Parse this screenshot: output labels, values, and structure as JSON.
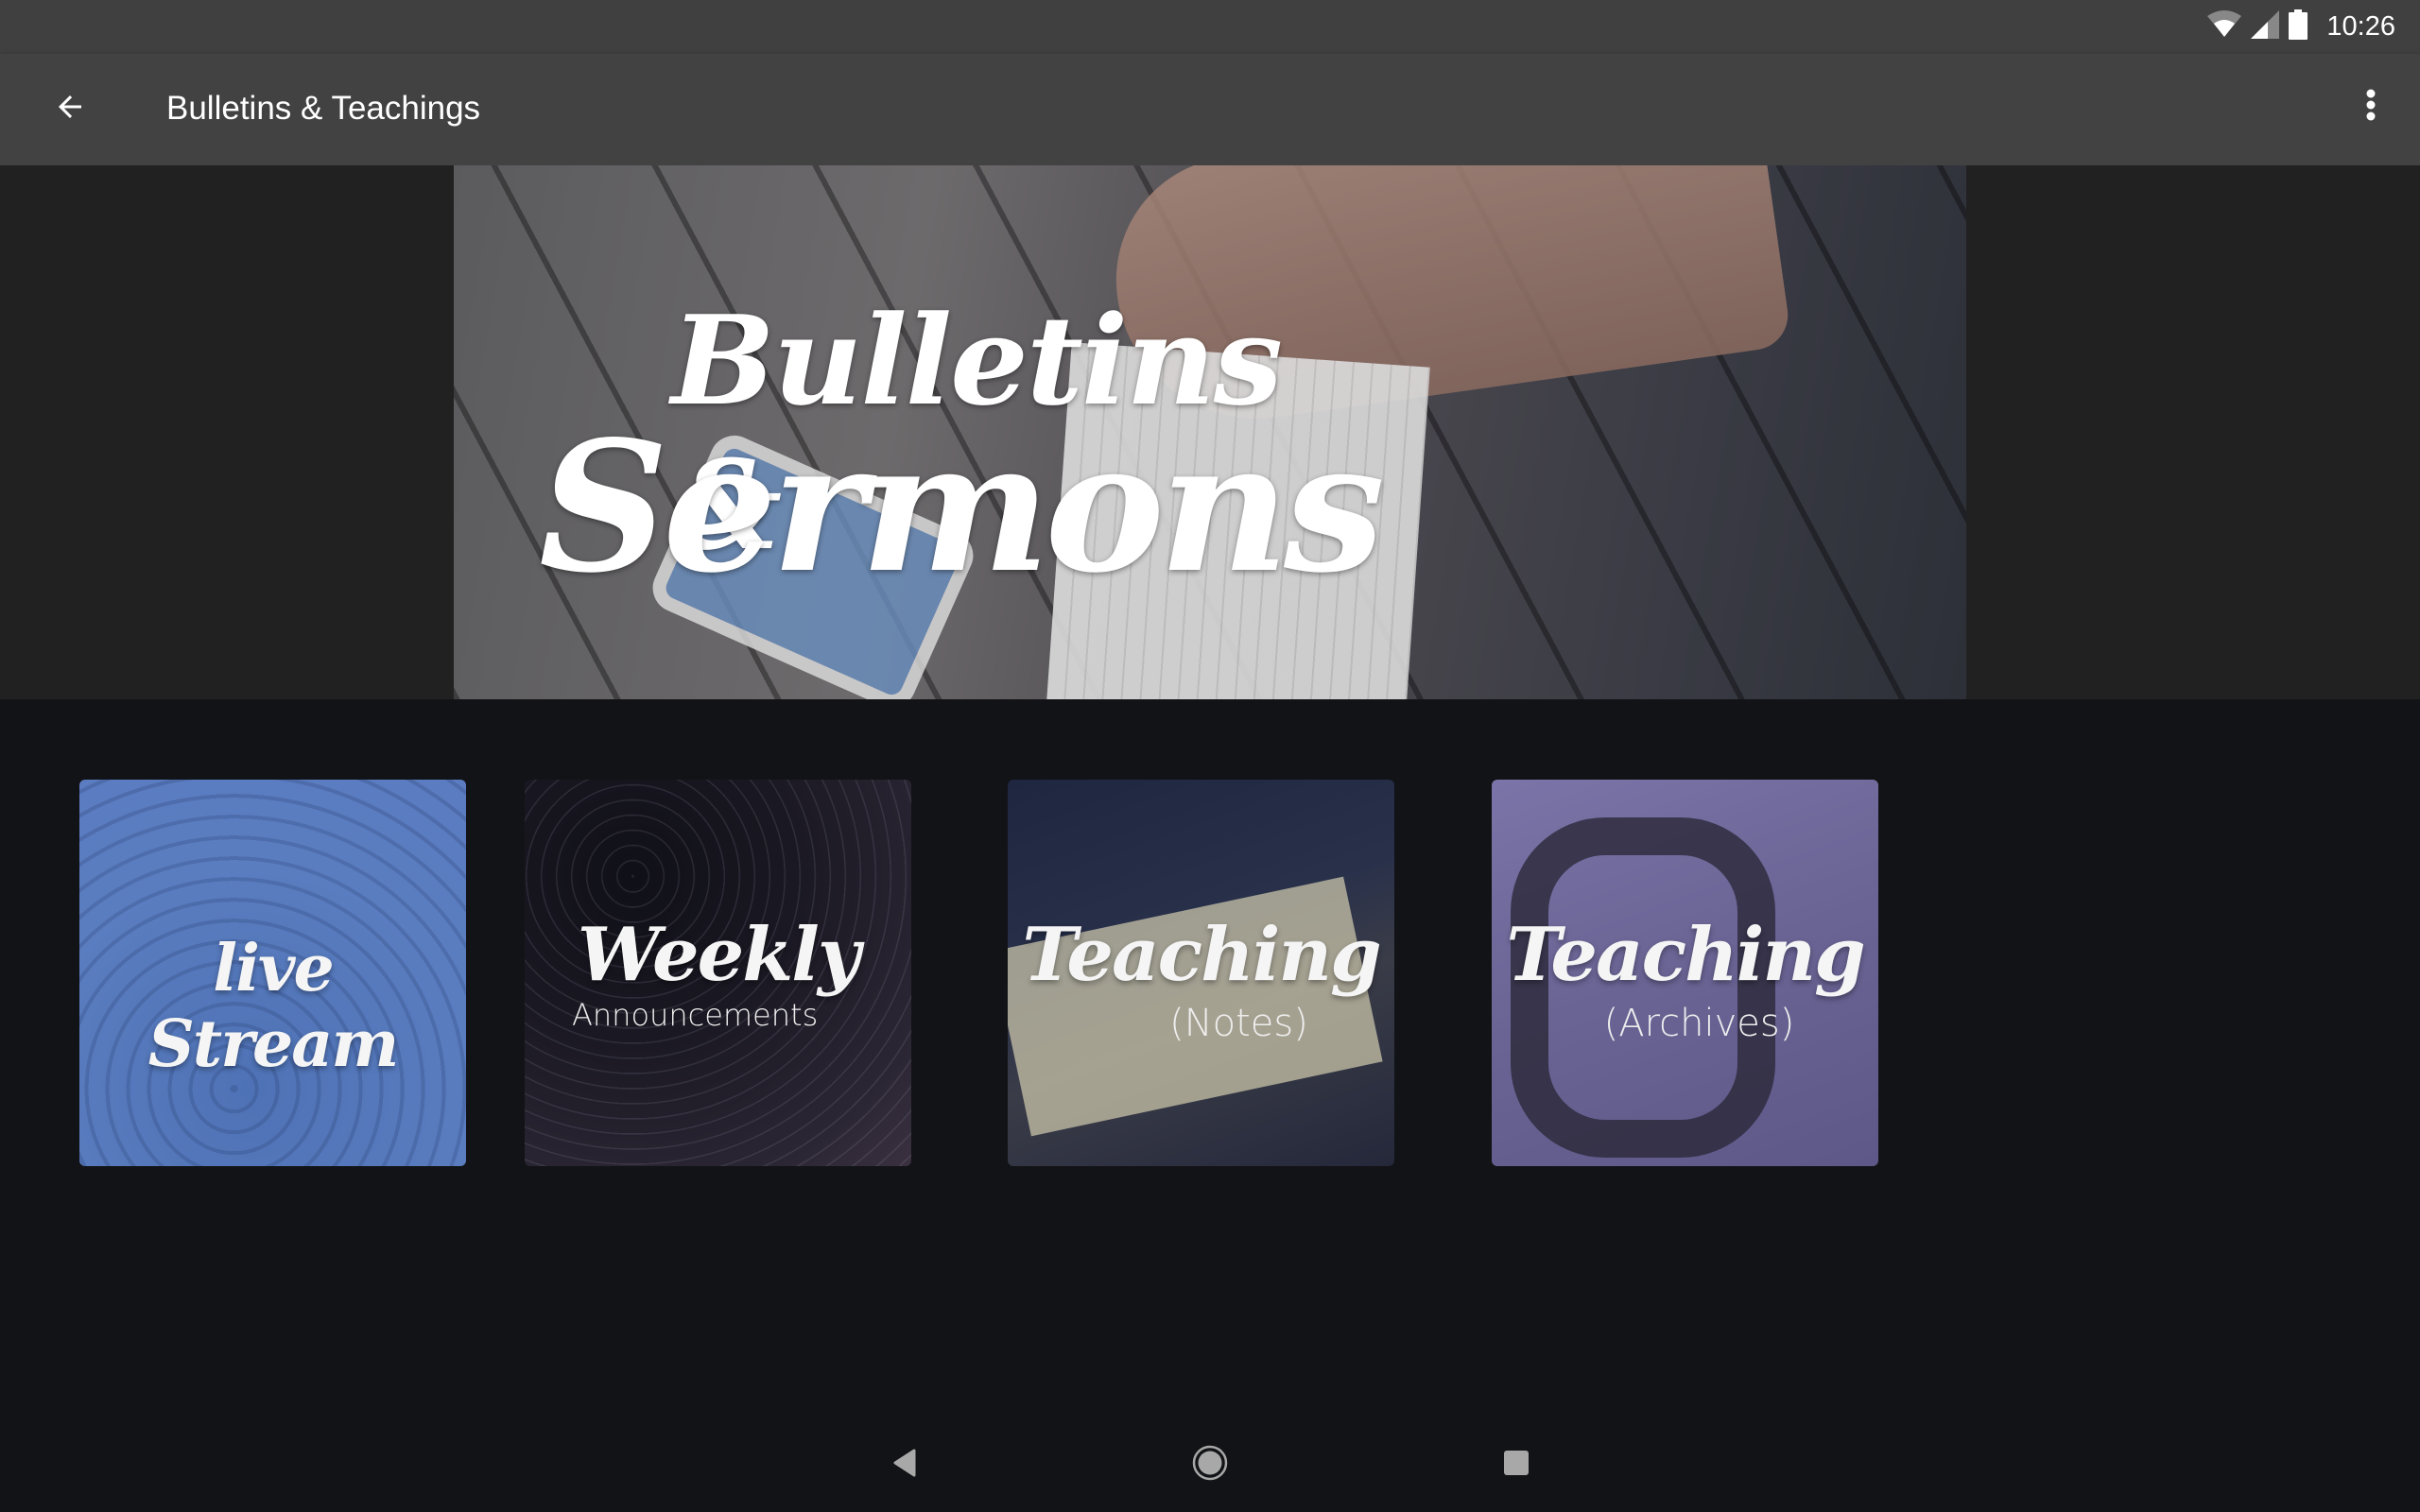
{
  "status_bar": {
    "time": "10:26",
    "icons": [
      "wifi-icon",
      "cell-signal-icon",
      "battery-icon"
    ]
  },
  "app_bar": {
    "title": "Bulletins & Teachings",
    "back_icon": "arrow-left-icon",
    "overflow_icon": "more-vert-icon"
  },
  "banner": {
    "line1": "Bulletins &",
    "line2": "Sermons"
  },
  "tiles": [
    {
      "title": "live Stream",
      "subtitle": "",
      "color": "#5a7dc0"
    },
    {
      "title": "Weekly",
      "subtitle": "Announcements",
      "color": "#1a1822"
    },
    {
      "title": "Teaching",
      "subtitle": "(Notes)",
      "color": "#28304a"
    },
    {
      "title": "Teaching",
      "subtitle": "(Archives)",
      "color": "#6a6494"
    }
  ],
  "nav_bar": {
    "back": "nav-back-icon",
    "home": "nav-home-icon",
    "recents": "nav-recents-icon"
  },
  "colors": {
    "status_bar": "#404040",
    "app_bar": "#424242",
    "banner_side": "#212121",
    "background": "#121316"
  }
}
